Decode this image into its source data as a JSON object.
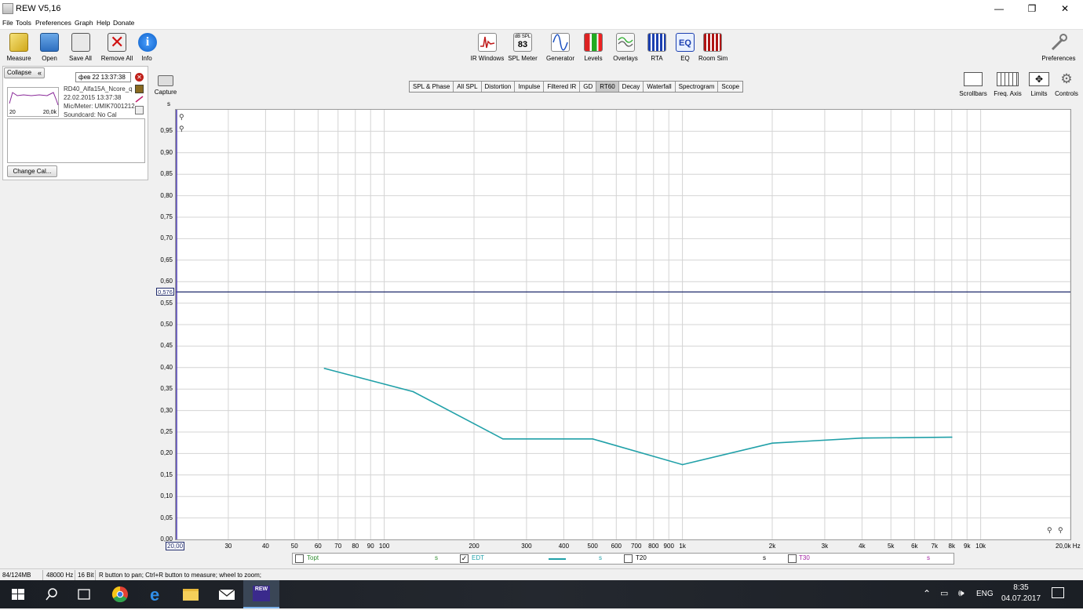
{
  "window": {
    "title": "REW V5,16",
    "minimize": "—",
    "restore": "❐",
    "close": "✕"
  },
  "menu": [
    "File",
    "Tools",
    "Preferences",
    "Graph",
    "Help",
    "Donate"
  ],
  "toolbar_left": [
    {
      "label": "Measure",
      "icon": "measure-icon"
    },
    {
      "label": "Open",
      "icon": "open-folder-icon"
    },
    {
      "label": "Save All",
      "icon": "save-icon"
    },
    {
      "label": "Remove All",
      "icon": "remove-icon"
    },
    {
      "label": "Info",
      "icon": "info-icon"
    }
  ],
  "toolbar_center": [
    {
      "label": "IR Windows",
      "icon": "ir-windows-icon"
    },
    {
      "label": "SPL Meter",
      "icon": "spl-meter-icon",
      "badge_top": "dB SPL",
      "badge_value": "83"
    },
    {
      "label": "Generator",
      "icon": "generator-icon"
    },
    {
      "label": "Levels",
      "icon": "levels-icon"
    },
    {
      "label": "Overlays",
      "icon": "overlays-icon"
    },
    {
      "label": "RTA",
      "icon": "rta-icon"
    },
    {
      "label": "EQ",
      "icon": "eq-icon",
      "badge_value": "EQ"
    },
    {
      "label": "Room Sim",
      "icon": "room-sim-icon"
    }
  ],
  "toolbar_right": {
    "label": "Preferences",
    "icon": "wrench-icon"
  },
  "graph_tools": [
    {
      "label": "Scrollbars",
      "icon": "scrollbars-icon"
    },
    {
      "label": "Freq. Axis",
      "icon": "freq-axis-icon"
    },
    {
      "label": "Limits",
      "icon": "limits-icon"
    },
    {
      "label": "Controls",
      "icon": "gear-icon"
    }
  ],
  "capture": {
    "label": "Capture",
    "icon": "camera-icon"
  },
  "panel": {
    "collapse": "Collapse",
    "date": "фев 22 13:37:38",
    "name": "RD40_Alfa15A_Ncore_q",
    "datetime": "22.02.2015 13:37:38",
    "mic": "Mic/Meter: UMIK7001212",
    "soundcard": "Soundcard: No Cal",
    "thumb_min": "20",
    "thumb_max": "20,0k",
    "change_cal": "Change Cal..."
  },
  "tabs": [
    "SPL & Phase",
    "All SPL",
    "Distortion",
    "Impulse",
    "Filtered IR",
    "GD",
    "RT60",
    "Decay",
    "Waterfall",
    "Spectrogram",
    "Scope"
  ],
  "active_tab": "RT60",
  "legend": [
    {
      "name": "Topt",
      "unit": "s",
      "checked": false,
      "color": "#2e8b2e"
    },
    {
      "name": "EDT",
      "unit": "s",
      "checked": true,
      "color": "#20a0a8"
    },
    {
      "name": "T20",
      "unit": "s",
      "checked": false,
      "color": "#000000"
    },
    {
      "name": "T30",
      "unit": "s",
      "checked": false,
      "color": "#a020a0"
    }
  ],
  "status": {
    "memory": "84/124MB",
    "rate": "48000 Hz",
    "bits": "16 Bit",
    "hint": "R button to pan; Ctrl+R button to measure; wheel to zoom;"
  },
  "taskbar": {
    "app": "REW",
    "lang": "ENG",
    "time": "8:35",
    "date": "04.07.2017"
  },
  "chart_data": {
    "type": "line",
    "ylabel": "s",
    "xscale": "log",
    "xlim": [
      20,
      20000
    ],
    "ylim": [
      0,
      1.0
    ],
    "y_ticks": [
      "0,00",
      "0,05",
      "0,10",
      "0,15",
      "0,20",
      "0,25",
      "0,30",
      "0,35",
      "0,40",
      "0,45",
      "0,50",
      "0,55",
      "0,60",
      "0,65",
      "0,70",
      "0,75",
      "0,80",
      "0,85",
      "0,90",
      "0,95"
    ],
    "x_tick_labels": [
      "20,00",
      "30",
      "40",
      "50",
      "60",
      "70",
      "80",
      "90",
      "100",
      "200",
      "300",
      "400",
      "500",
      "600",
      "700",
      "800",
      "900",
      "1k",
      "2k",
      "3k",
      "4k",
      "5k",
      "6k",
      "7k",
      "8k",
      "9k",
      "10k",
      "20,0k Hz"
    ],
    "x_tick_values": [
      20,
      30,
      40,
      50,
      60,
      70,
      80,
      90,
      100,
      200,
      300,
      400,
      500,
      600,
      700,
      800,
      900,
      1000,
      2000,
      3000,
      4000,
      5000,
      6000,
      7000,
      8000,
      9000,
      10000,
      20000
    ],
    "cursor": {
      "y": 0.576,
      "label": "0,576"
    },
    "series": [
      {
        "name": "EDT",
        "color": "#20a0a8",
        "x": [
          63,
          125,
          250,
          500,
          1000,
          2000,
          4000,
          8000
        ],
        "y": [
          0.398,
          0.344,
          0.234,
          0.234,
          0.174,
          0.224,
          0.236,
          0.238
        ]
      }
    ]
  }
}
